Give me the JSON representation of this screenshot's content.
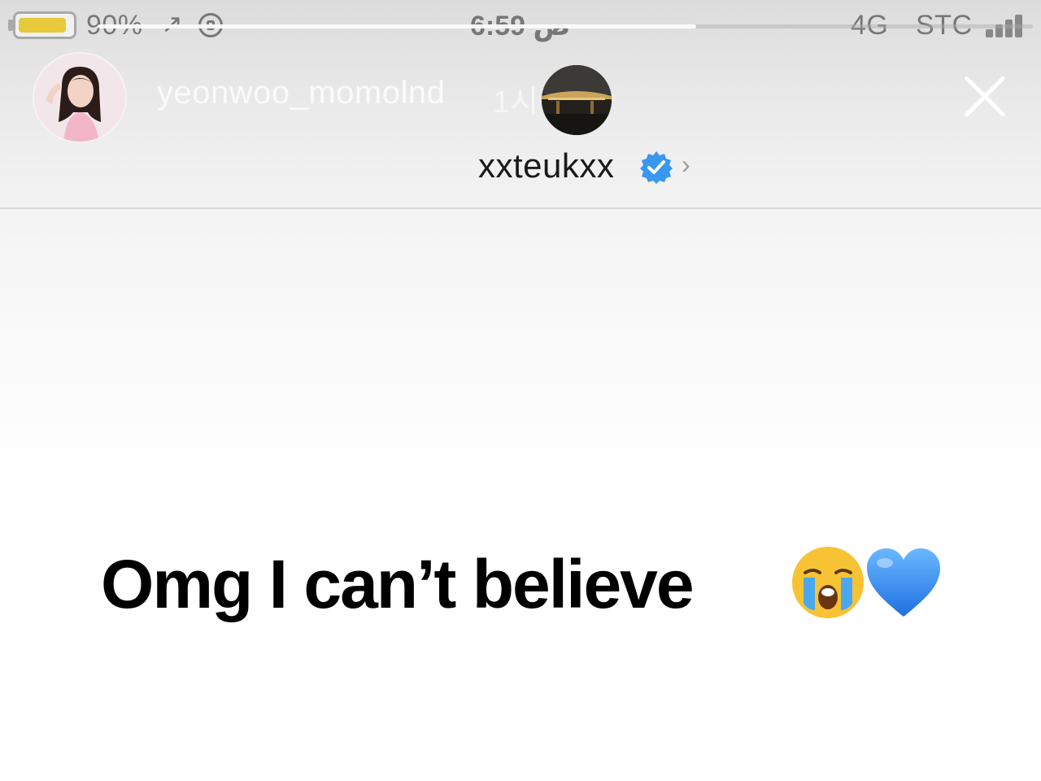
{
  "status_bar": {
    "battery_percent": "90%",
    "battery_level": 0.9,
    "arrow": "↗",
    "time": "ص 6:59",
    "network": "4G",
    "carrier": "STC"
  },
  "story": {
    "username": "yeonwoo_momolnd",
    "time_ago": "1시간",
    "progress": 0.64,
    "mention_username": "xxteukxx",
    "mention_chevron": "›",
    "caption_text": "Omg I can’t believe"
  },
  "icons": {
    "close": "close-icon",
    "verified": "verified-badge-icon",
    "emoji_1": "crying-face-emoji",
    "emoji_2": "blue-heart-emoji"
  },
  "colors": {
    "verified_blue": "#3897f0",
    "heart_blue": "#1e6fe0",
    "battery_yellow": "#e8c93a"
  }
}
